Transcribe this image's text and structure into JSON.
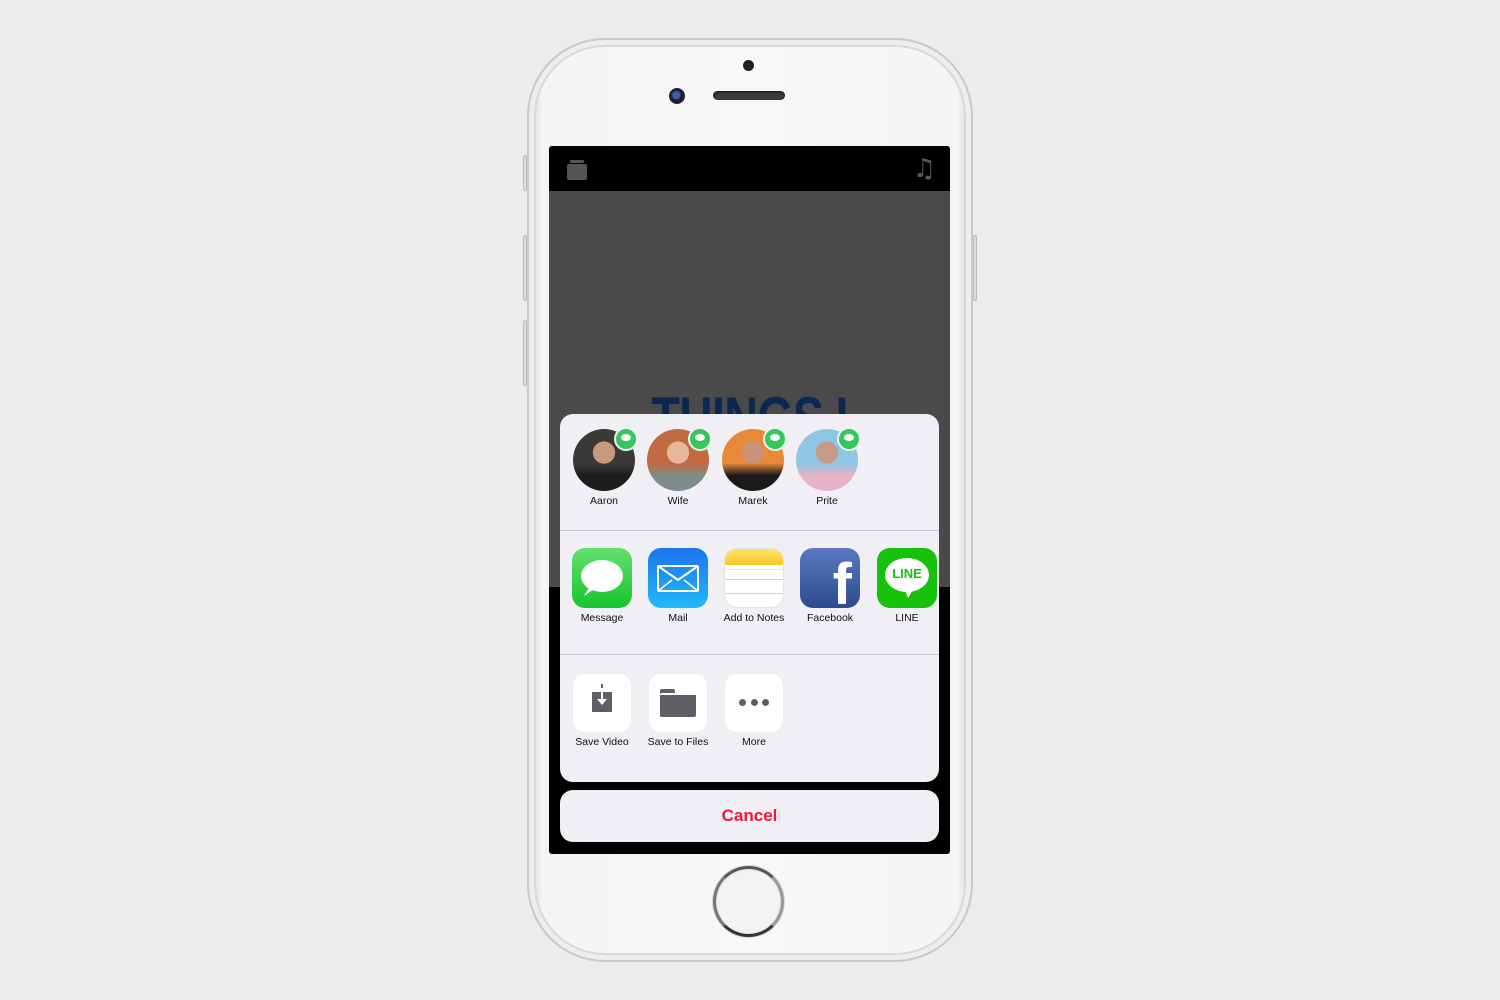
{
  "device": {
    "model": "iPhone (white)"
  },
  "app": {
    "top_bar": {
      "left_icon": "stack-icon",
      "right_icon": "music-note-icon",
      "right_glyph": "♫"
    },
    "video_title": "THINGS I LOVE!"
  },
  "share_sheet": {
    "people": [
      {
        "name": "Aaron",
        "badge": "messages-badge-icon",
        "avatar_colors": [
          "#3c3a38",
          "#c79a7d",
          "#1d1d1d"
        ]
      },
      {
        "name": "Wife",
        "badge": "messages-badge-icon",
        "avatar_colors": [
          "#c26a3f",
          "#e8b79b",
          "#7f8d8a"
        ]
      },
      {
        "name": "Marek",
        "badge": "messages-badge-icon",
        "avatar_colors": [
          "#e68a3a",
          "#c99177",
          "#1a1a1a"
        ]
      },
      {
        "name": "Prite",
        "badge": "messages-badge-icon",
        "avatar_colors": [
          "#8ec6e6",
          "#c99a83",
          "#e6b3c8"
        ]
      }
    ],
    "apps": [
      {
        "label": "Message",
        "icon": "messages-app-icon",
        "color": "#34c759"
      },
      {
        "label": "Mail",
        "icon": "mail-app-icon",
        "color": "#1f8ff5"
      },
      {
        "label": "Add to Notes",
        "icon": "notes-app-icon",
        "color": "#f8c928"
      },
      {
        "label": "Facebook",
        "icon": "facebook-app-icon",
        "color": "#3b5998",
        "glyph": "f"
      },
      {
        "label": "LINE",
        "icon": "line-app-icon",
        "color": "#17c20c",
        "glyph": "LINE"
      }
    ],
    "actions": [
      {
        "label": "Save Video",
        "icon": "save-video-icon"
      },
      {
        "label": "Save to Files",
        "icon": "folder-icon"
      },
      {
        "label": "More",
        "icon": "more-dots-icon"
      }
    ],
    "cancel_label": "Cancel",
    "cancel_color": "#f2163e"
  }
}
